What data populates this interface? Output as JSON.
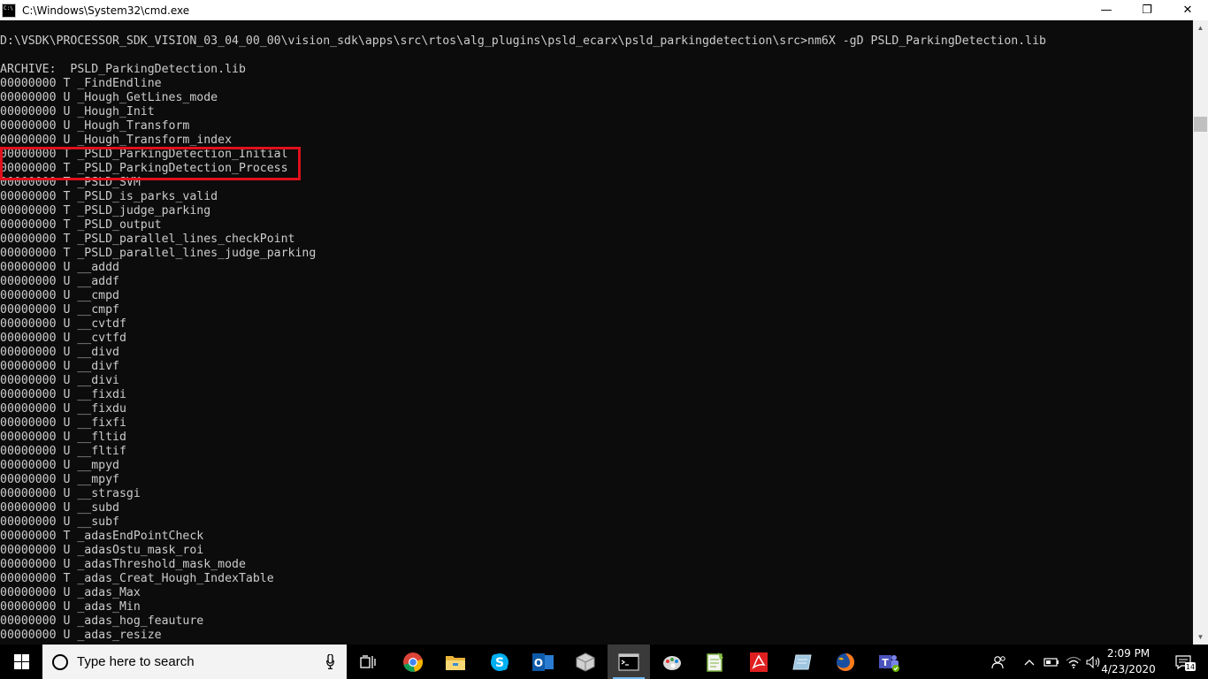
{
  "window": {
    "title": "C:\\Windows\\System32\\cmd.exe",
    "controls": {
      "minimize": "—",
      "maximize": "❐",
      "close": "✕"
    }
  },
  "console": {
    "lines": [
      "",
      "D:\\VSDK\\PROCESSOR_SDK_VISION_03_04_00_00\\vision_sdk\\apps\\src\\rtos\\alg_plugins\\psld_ecarx\\psld_parkingdetection\\src>nm6X -gD PSLD_ParkingDetection.lib",
      "",
      "ARCHIVE:  PSLD_ParkingDetection.lib",
      "00000000 T _FindEndline",
      "00000000 U _Hough_GetLines_mode",
      "00000000 U _Hough_Init",
      "00000000 U _Hough_Transform",
      "00000000 U _Hough_Transform_index",
      "00000000 T _PSLD_ParkingDetection_Initial",
      "00000000 T _PSLD_ParkingDetection_Process",
      "00000000 T _PSLD_SVM",
      "00000000 T _PSLD_is_parks_valid",
      "00000000 T _PSLD_judge_parking",
      "00000000 T _PSLD_output",
      "00000000 T _PSLD_parallel_lines_checkPoint",
      "00000000 T _PSLD_parallel_lines_judge_parking",
      "00000000 U __addd",
      "00000000 U __addf",
      "00000000 U __cmpd",
      "00000000 U __cmpf",
      "00000000 U __cvtdf",
      "00000000 U __cvtfd",
      "00000000 U __divd",
      "00000000 U __divf",
      "00000000 U __divi",
      "00000000 U __fixdi",
      "00000000 U __fixdu",
      "00000000 U __fixfi",
      "00000000 U __fltid",
      "00000000 U __fltif",
      "00000000 U __mpyd",
      "00000000 U __mpyf",
      "00000000 U __strasgi",
      "00000000 U __subd",
      "00000000 U __subf",
      "00000000 T _adasEndPointCheck",
      "00000000 U _adasOstu_mask_roi",
      "00000000 U _adasThreshold_mask_mode",
      "00000000 T _adas_Creat_Hough_IndexTable",
      "00000000 U _adas_Max",
      "00000000 U _adas_Min",
      "00000000 U _adas_hog_feauture",
      "00000000 U _adas_resize"
    ],
    "highlighted_lines": [
      "00000000 T _PSLD_ParkingDetection_Initial",
      "00000000 T _PSLD_ParkingDetection_Process"
    ],
    "highlight_color": "#e0101c",
    "text_color": "#cccccc",
    "background": "#0c0c0c"
  },
  "taskbar": {
    "search_placeholder": "Type here to search",
    "apps": [
      {
        "icon": "task-view-icon",
        "running": false
      },
      {
        "icon": "chrome-icon",
        "running": false
      },
      {
        "icon": "file-explorer-icon",
        "running": false
      },
      {
        "icon": "skype-icon",
        "running": false
      },
      {
        "icon": "outlook-icon",
        "running": false
      },
      {
        "icon": "package-cube-icon",
        "running": false
      },
      {
        "icon": "cmd-icon",
        "running": true
      },
      {
        "icon": "paint-icon",
        "running": false
      },
      {
        "icon": "notepad-plus-icon",
        "running": false
      },
      {
        "icon": "acrobat-icon",
        "running": false
      },
      {
        "icon": "notes-icon",
        "running": false
      },
      {
        "icon": "firefox-icon",
        "running": false
      },
      {
        "icon": "teams-icon",
        "running": false
      }
    ],
    "tray": {
      "people_icon": "people-icon",
      "overflow_icon": "chevron-up-icon",
      "battery_icon": "battery-icon",
      "network_icon": "wifi-icon",
      "volume_icon": "volume-icon",
      "time": "2:09 PM",
      "date": "4/23/2020",
      "notification_count": "14"
    }
  }
}
